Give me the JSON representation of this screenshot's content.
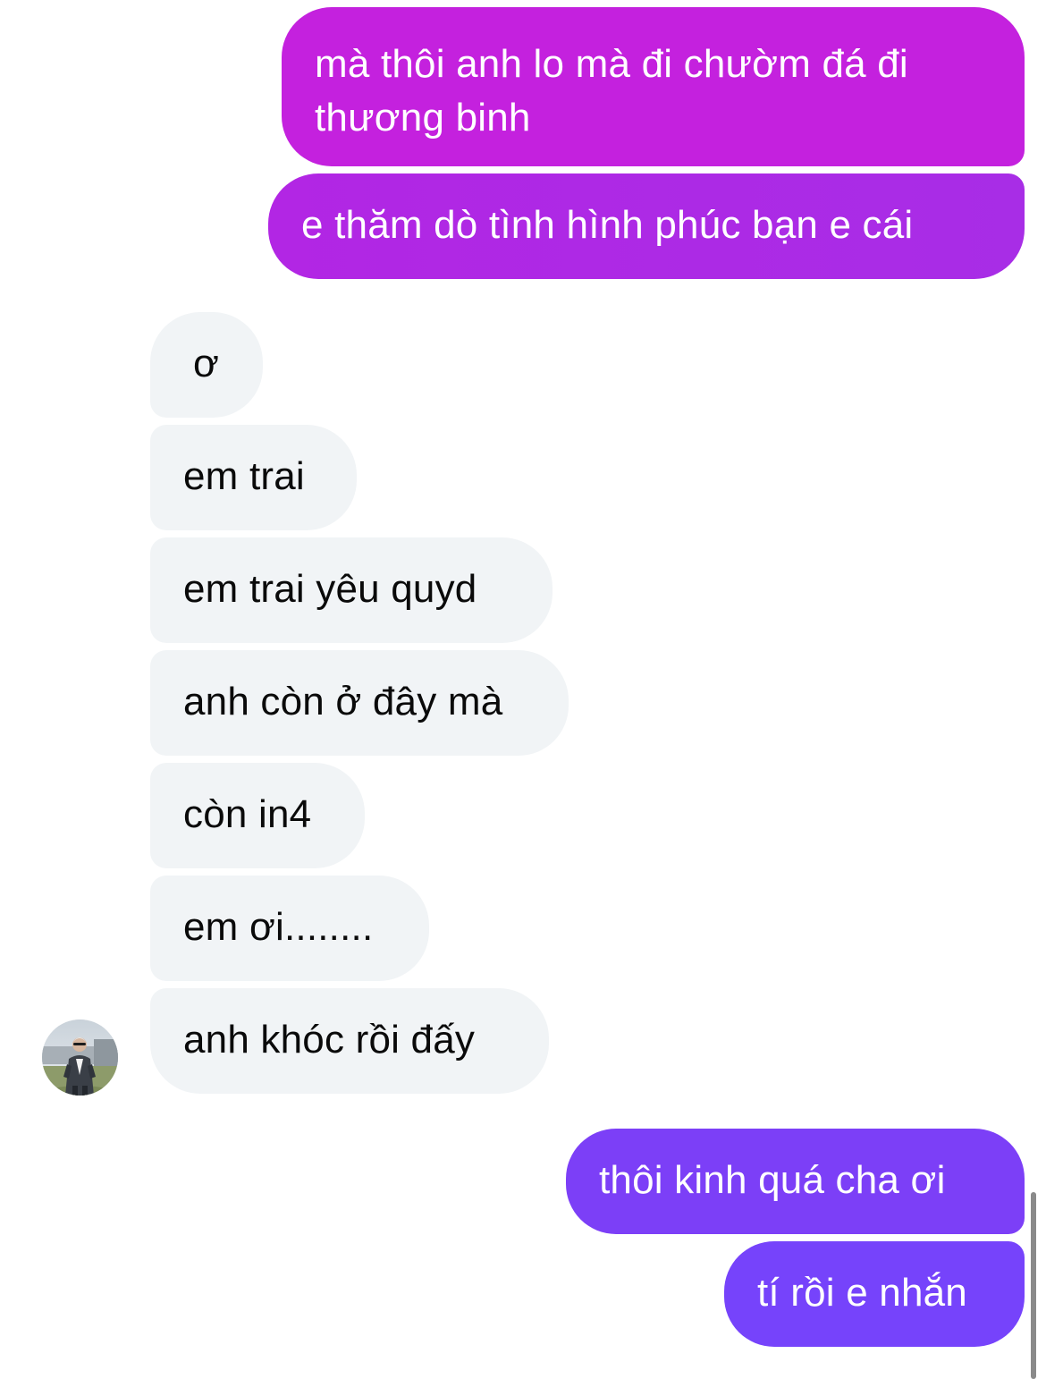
{
  "messages": [
    {
      "sender": "me",
      "text": "mà thôi anh lo mà đi chườm đá đi thương binh"
    },
    {
      "sender": "me",
      "text": "e thăm dò tình hình phúc bạn e cái"
    },
    {
      "sender": "them",
      "text": "ơ"
    },
    {
      "sender": "them",
      "text": "em trai"
    },
    {
      "sender": "them",
      "text": "em trai yêu quyd"
    },
    {
      "sender": "them",
      "text": "anh còn ở đây mà"
    },
    {
      "sender": "them",
      "text": "còn in4"
    },
    {
      "sender": "them",
      "text": "em ơi........"
    },
    {
      "sender": "them",
      "text": "anh khóc rồi đấy"
    },
    {
      "sender": "me",
      "text": "thôi kinh quá cha ơi"
    },
    {
      "sender": "me",
      "text": "tí rồi e nhắn"
    }
  ],
  "colors": {
    "outgoing_top": "#c421de",
    "outgoing_mid": "#b226e4",
    "outgoing_bottom": "#7643fb",
    "incoming_bg": "#f1f4f6",
    "incoming_text": "#0a0a0a"
  },
  "contact": {
    "avatar_icon": "contact-avatar-photo"
  }
}
